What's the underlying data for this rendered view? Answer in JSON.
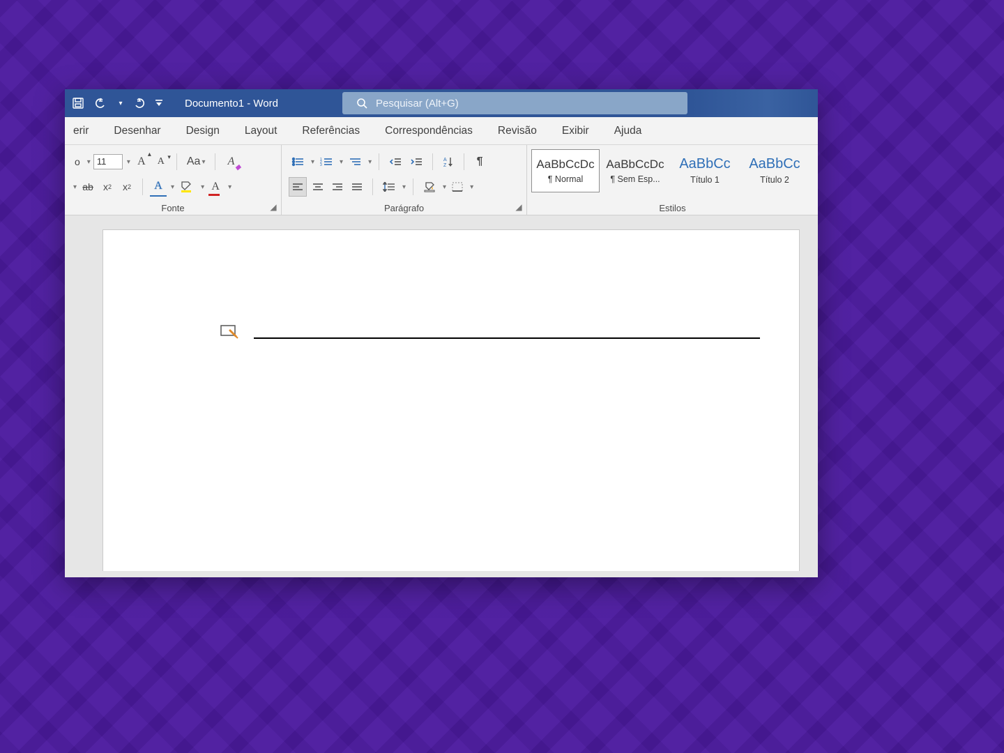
{
  "app": {
    "title": "Documento1 - Word"
  },
  "search": {
    "placeholder": "Pesquisar (Alt+G)"
  },
  "tabs": {
    "items": [
      {
        "label": "erir"
      },
      {
        "label": "Desenhar"
      },
      {
        "label": "Design"
      },
      {
        "label": "Layout"
      },
      {
        "label": "Referências"
      },
      {
        "label": "Correspondências"
      },
      {
        "label": "Revisão"
      },
      {
        "label": "Exibir"
      },
      {
        "label": "Ajuda"
      }
    ]
  },
  "ribbon": {
    "font_group_label": "Fonte",
    "paragraph_group_label": "Parágrafo",
    "styles_group_label": "Estilos",
    "font_name_fragment": "o",
    "font_size": "11",
    "case_btn": "Aa"
  },
  "styles": {
    "items": [
      {
        "sample": "AaBbCcDc",
        "label": "¶ Normal",
        "blue": false,
        "active": true
      },
      {
        "sample": "AaBbCcDc",
        "label": "¶ Sem Esp...",
        "blue": false,
        "active": false
      },
      {
        "sample": "AaBbCc",
        "label": "Título 1",
        "blue": true,
        "active": false
      },
      {
        "sample": "AaBbCc",
        "label": "Título 2",
        "blue": true,
        "active": false
      }
    ]
  },
  "colors": {
    "title_bar": "#2f5597",
    "search_bg": "#89a6c8",
    "purple_bg": "#4b1a9e",
    "accent_blue": "#2f6fb7",
    "highlight_yellow": "#ffe600",
    "font_color_red": "#d02424"
  }
}
